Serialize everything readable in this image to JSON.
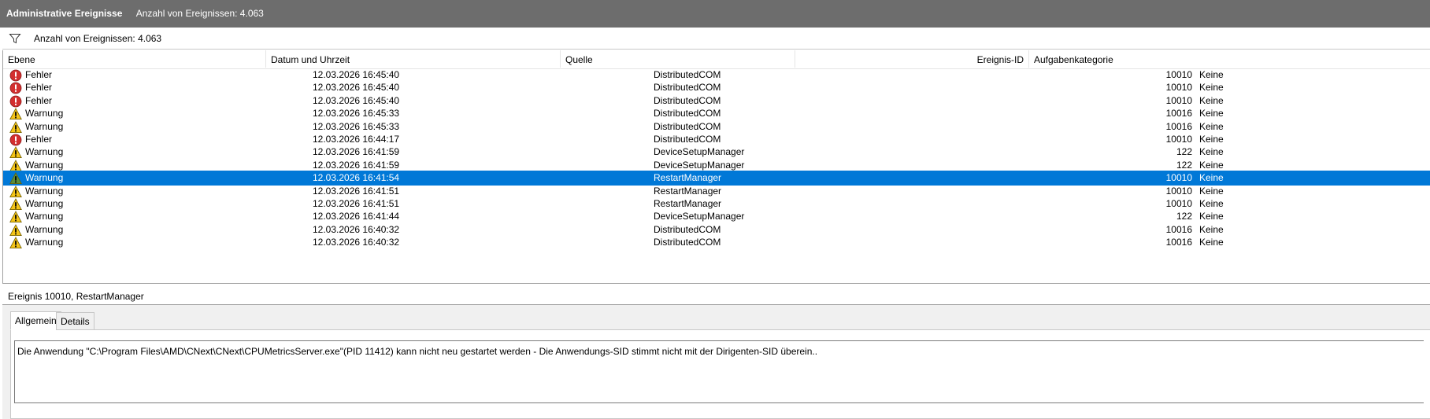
{
  "title": {
    "name": "Administrative Ereignisse",
    "count": "Anzahl von Ereignissen: 4.063"
  },
  "filter": {
    "icon": "filter-icon",
    "text": "Anzahl von Ereignissen: 4.063"
  },
  "columns": {
    "level": "Ebene",
    "date": "Datum und Uhrzeit",
    "source": "Quelle",
    "id": "Ereignis-ID",
    "category": "Aufgabenkategorie"
  },
  "colors": {
    "selection": "#0078d7",
    "error": "#d32f2f",
    "warning": "#f5c518"
  },
  "events": [
    {
      "type": "error",
      "level": "Fehler",
      "date": "12.03.2026 16:45:40",
      "source": "DistributedCOM",
      "id": "10010",
      "category": "Keine"
    },
    {
      "type": "error",
      "level": "Fehler",
      "date": "12.03.2026 16:45:40",
      "source": "DistributedCOM",
      "id": "10010",
      "category": "Keine"
    },
    {
      "type": "error",
      "level": "Fehler",
      "date": "12.03.2026 16:45:40",
      "source": "DistributedCOM",
      "id": "10010",
      "category": "Keine"
    },
    {
      "type": "warning",
      "level": "Warnung",
      "date": "12.03.2026 16:45:33",
      "source": "DistributedCOM",
      "id": "10016",
      "category": "Keine"
    },
    {
      "type": "warning",
      "level": "Warnung",
      "date": "12.03.2026 16:45:33",
      "source": "DistributedCOM",
      "id": "10016",
      "category": "Keine"
    },
    {
      "type": "error",
      "level": "Fehler",
      "date": "12.03.2026 16:44:17",
      "source": "DistributedCOM",
      "id": "10010",
      "category": "Keine"
    },
    {
      "type": "warning",
      "level": "Warnung",
      "date": "12.03.2026 16:41:59",
      "source": "DeviceSetupManager",
      "id": "122",
      "category": "Keine"
    },
    {
      "type": "warning",
      "level": "Warnung",
      "date": "12.03.2026 16:41:59",
      "source": "DeviceSetupManager",
      "id": "122",
      "category": "Keine"
    },
    {
      "type": "warning",
      "level": "Warnung",
      "date": "12.03.2026 16:41:54",
      "source": "RestartManager",
      "id": "10010",
      "category": "Keine",
      "selected": true
    },
    {
      "type": "warning",
      "level": "Warnung",
      "date": "12.03.2026 16:41:51",
      "source": "RestartManager",
      "id": "10010",
      "category": "Keine"
    },
    {
      "type": "warning",
      "level": "Warnung",
      "date": "12.03.2026 16:41:51",
      "source": "RestartManager",
      "id": "10010",
      "category": "Keine"
    },
    {
      "type": "warning",
      "level": "Warnung",
      "date": "12.03.2026 16:41:44",
      "source": "DeviceSetupManager",
      "id": "122",
      "category": "Keine"
    },
    {
      "type": "warning",
      "level": "Warnung",
      "date": "12.03.2026 16:40:32",
      "source": "DistributedCOM",
      "id": "10016",
      "category": "Keine"
    },
    {
      "type": "warning",
      "level": "Warnung",
      "date": "12.03.2026 16:40:32",
      "source": "DistributedCOM",
      "id": "10016",
      "category": "Keine"
    }
  ],
  "detail": {
    "header": "Ereignis 10010, RestartManager",
    "tabs": {
      "general": "Allgemein",
      "details": "Details"
    },
    "message": "Die Anwendung \"C:\\Program Files\\AMD\\CNext\\CNext\\CPUMetricsServer.exe\"(PID 11412) kann  nicht neu gestartet werden - Die Anwendungs-SID stimmt nicht mit der Dirigenten-SID überein.."
  }
}
